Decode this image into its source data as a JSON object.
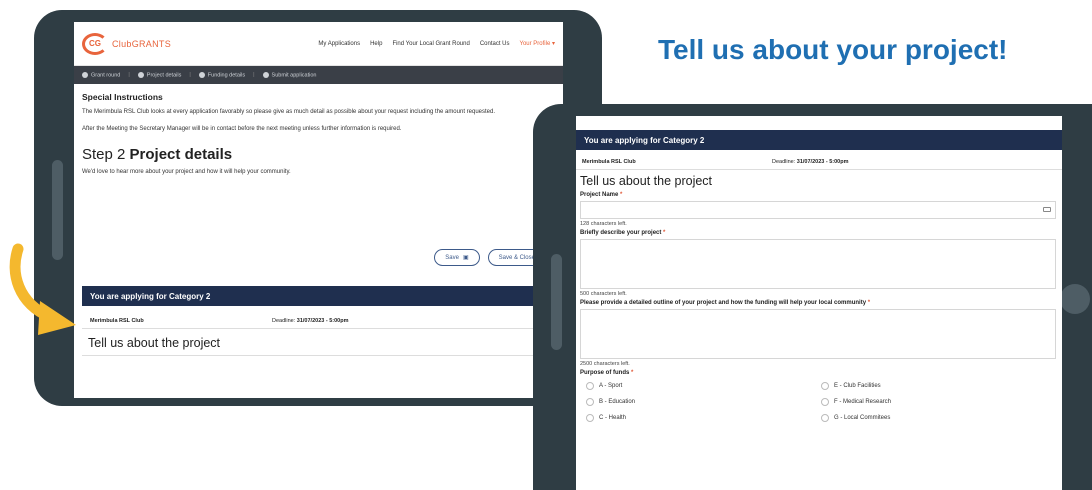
{
  "headline": "Tell us about your project!",
  "left_screen": {
    "logo_mark": "CG",
    "logo_text": "ClubGRANTS",
    "nav": [
      "My Applications",
      "Help",
      "Find Your Local Grant Round",
      "Contact Us"
    ],
    "nav_profile": "Your Profile ▾",
    "steps": [
      "Grant round",
      "Project details",
      "Funding details",
      "Submit application"
    ],
    "special_title": "Special Instructions",
    "special_p1": "The Merimbula RSL Club looks at every application favorably so please give as much detail as possible about your request including the amount requested.",
    "special_p2": "After the Meeting the Secretary Manager will be in contact before the next meeting unless further information is required.",
    "step_prefix": "Step 2",
    "step_title": "Project details",
    "step_sub": "We'd love to hear more about your project and how it will help your community.",
    "save_label": "Save",
    "save_close_label": "Save & Close",
    "category_bar": "You are applying for Category 2",
    "club": "Merimbula RSL Club",
    "deadline_label": "Deadline:",
    "deadline_value": "31/07/2023 - 5:00pm",
    "tell": "Tell us about the project"
  },
  "right_screen": {
    "category_bar": "You are applying for Category 2",
    "club": "Merimbula RSL Club",
    "deadline_label": "Deadline:",
    "deadline_value": "31/07/2023 - 5:00pm",
    "tell": "Tell us about the project",
    "project_name_label": "Project Name",
    "project_name_hint": "128 characters left.",
    "describe_label": "Briefly describe your project",
    "describe_hint": "500 characters left.",
    "outline_label": "Please provide a detailed outline of your project and how the funding will help your local community",
    "outline_hint": "2500 characters left.",
    "purpose_label": "Purpose of funds",
    "required_mark": "*",
    "purposes": [
      "A - Sport",
      "E - Club Facilities",
      "B - Education",
      "F - Medical Research",
      "C - Health",
      "G - Local Commitees"
    ]
  },
  "colors": {
    "headline": "#1f6fb2",
    "frame": "#2f3d44",
    "category_bar": "#1f2f4f",
    "accent": "#e8643c",
    "arrow": "#f4b82e"
  }
}
